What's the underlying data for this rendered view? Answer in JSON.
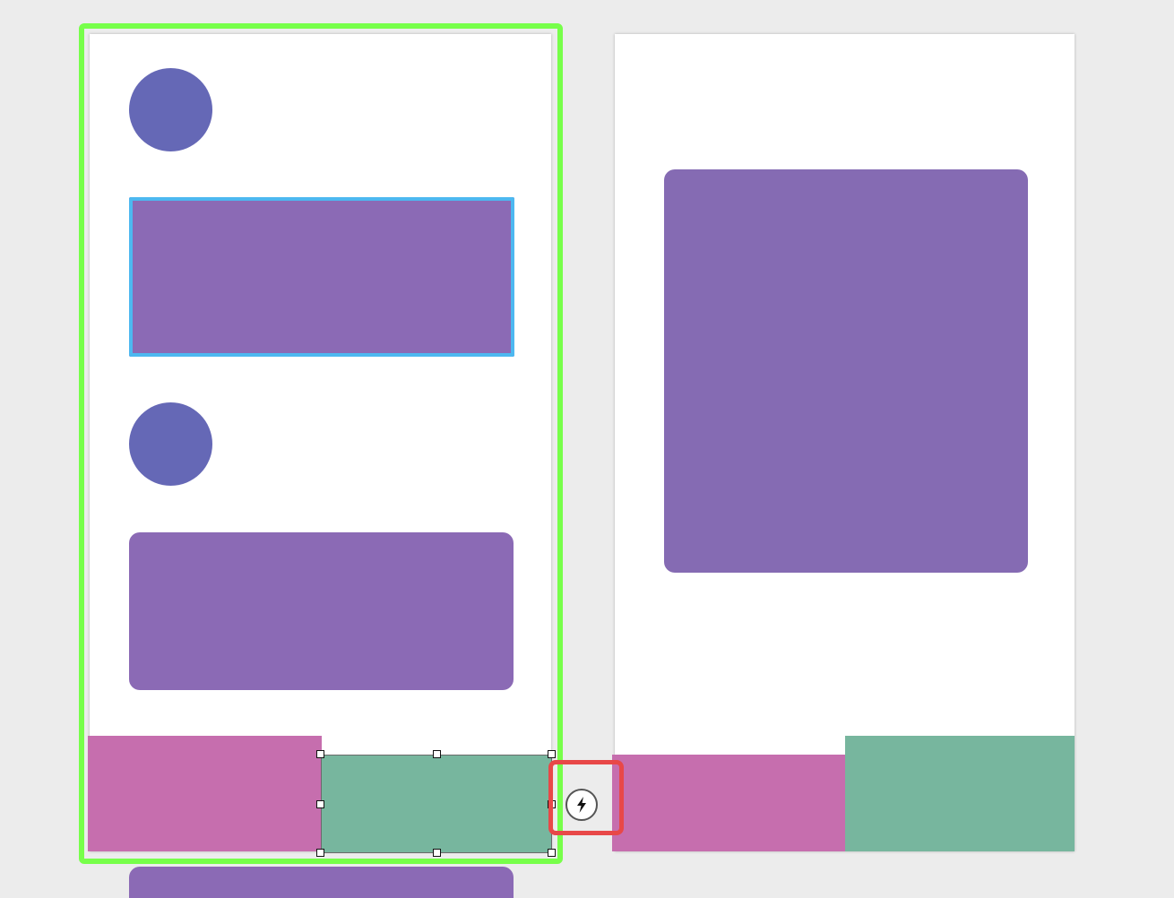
{
  "colors": {
    "canvas_bg": "#ececec",
    "artboard_bg": "#ffffff",
    "avatar": "#6568b6",
    "card_purple_1": "#8b6ab5",
    "card_purple_2": "#856bb3",
    "tab_pink": "#c66eae",
    "tab_green": "#77b69e",
    "selection_outline": "#77ff4a",
    "focus_outline": "#4db8f0",
    "interaction_highlight": "#e84848"
  },
  "artboards": [
    {
      "name": "artboard-1",
      "selected": true,
      "elements": [
        "avatar",
        "card",
        "avatar",
        "card",
        "tab-bar-left",
        "tab-bar-right",
        "card"
      ]
    },
    {
      "name": "artboard-2",
      "selected": false,
      "elements": [
        "card",
        "tab-bar-left",
        "tab-bar-right"
      ]
    }
  ],
  "selection": {
    "selected_layer": "a1-tab-right",
    "handles": [
      "top-left",
      "top-center",
      "top-right",
      "middle-left",
      "middle-right",
      "bottom-left",
      "bottom-center",
      "bottom-right"
    ]
  },
  "interaction": {
    "icon": "lightning-bolt-icon",
    "connects": [
      "artboard-1",
      "artboard-2"
    ]
  }
}
